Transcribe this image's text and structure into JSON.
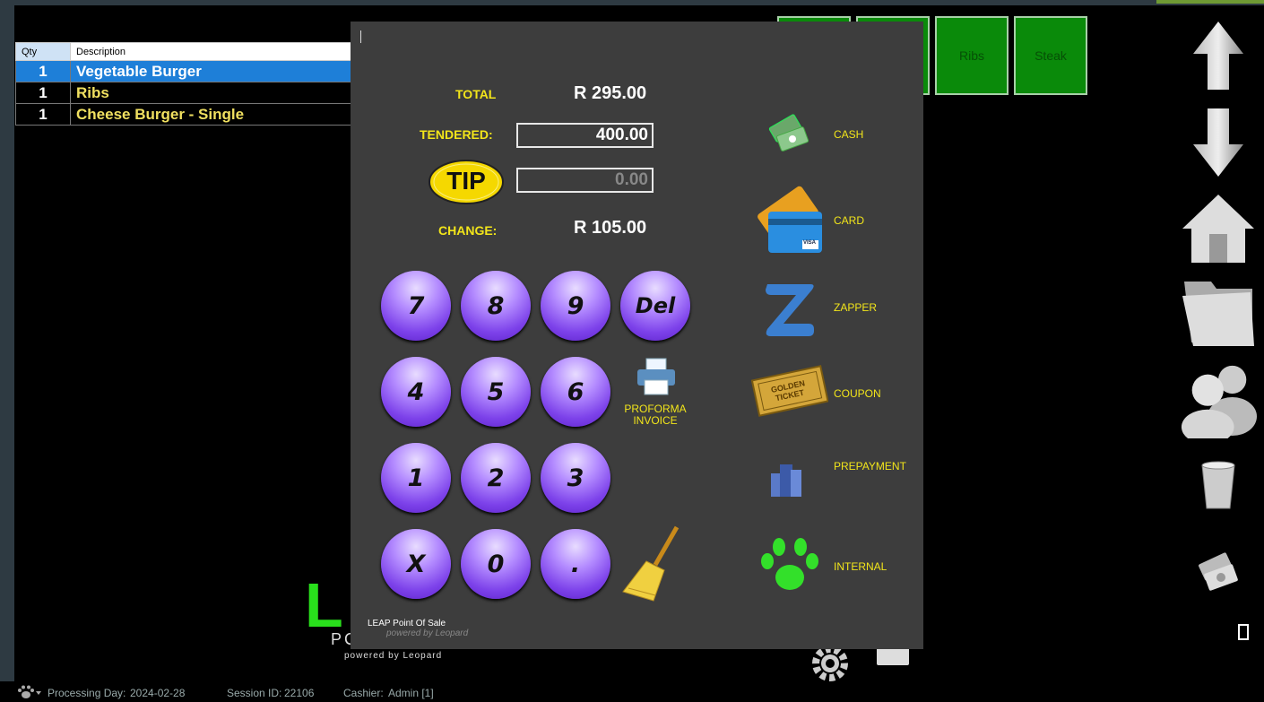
{
  "order": {
    "headers": {
      "qty": "Qty",
      "description": "Description"
    },
    "rows": [
      {
        "qty": "1",
        "description": "Vegetable Burger"
      },
      {
        "qty": "1",
        "description": "Ribs"
      },
      {
        "qty": "1",
        "description": "Cheese Burger - Single"
      }
    ]
  },
  "products": {
    "ribs": "Ribs",
    "steak": "Steak"
  },
  "payment": {
    "total_label": "TOTAL",
    "total_value": "R 295.00",
    "tendered_label": "TENDERED:",
    "tendered_value": "400.00",
    "tip_label": "TIP",
    "tip_value": "0.00",
    "change_label": "CHANGE:",
    "change_value": "R 105.00"
  },
  "keypad": {
    "k7": "7",
    "k8": "8",
    "k9": "9",
    "del": "Del",
    "k4": "4",
    "k5": "5",
    "k6": "6",
    "k1": "1",
    "k2": "2",
    "k3": "3",
    "x": "X",
    "k0": "0",
    "dot": "."
  },
  "proforma": {
    "line1": "PROFORMA",
    "line2": "INVOICE"
  },
  "methods": {
    "cash": "CASH",
    "card": "CARD",
    "zapper": "ZAPPER",
    "coupon": "COUPON",
    "prepayment": "PREPAYMENT",
    "internal": "INTERNAL"
  },
  "coupon_ticket_text": "GOLDEN TICKET",
  "card_text": "VISA",
  "modal_footer": {
    "title": "LEAP Point Of Sale",
    "sub": "powered by Leopard"
  },
  "brand": {
    "logo_letter": "L",
    "logo_partial": "PC",
    "powered": "powered by Leopard"
  },
  "status": {
    "processing_day_label": "Processing Day:",
    "processing_day": "2024-02-28",
    "session_label": "Session ID:",
    "session_id": "22106",
    "cashier_label": "Cashier:",
    "cashier": "Admin [1]"
  },
  "colors": {
    "accent_yellow": "#f2e51a",
    "selected_row": "#1e7fd8",
    "product_green": "#0a8a0a"
  }
}
